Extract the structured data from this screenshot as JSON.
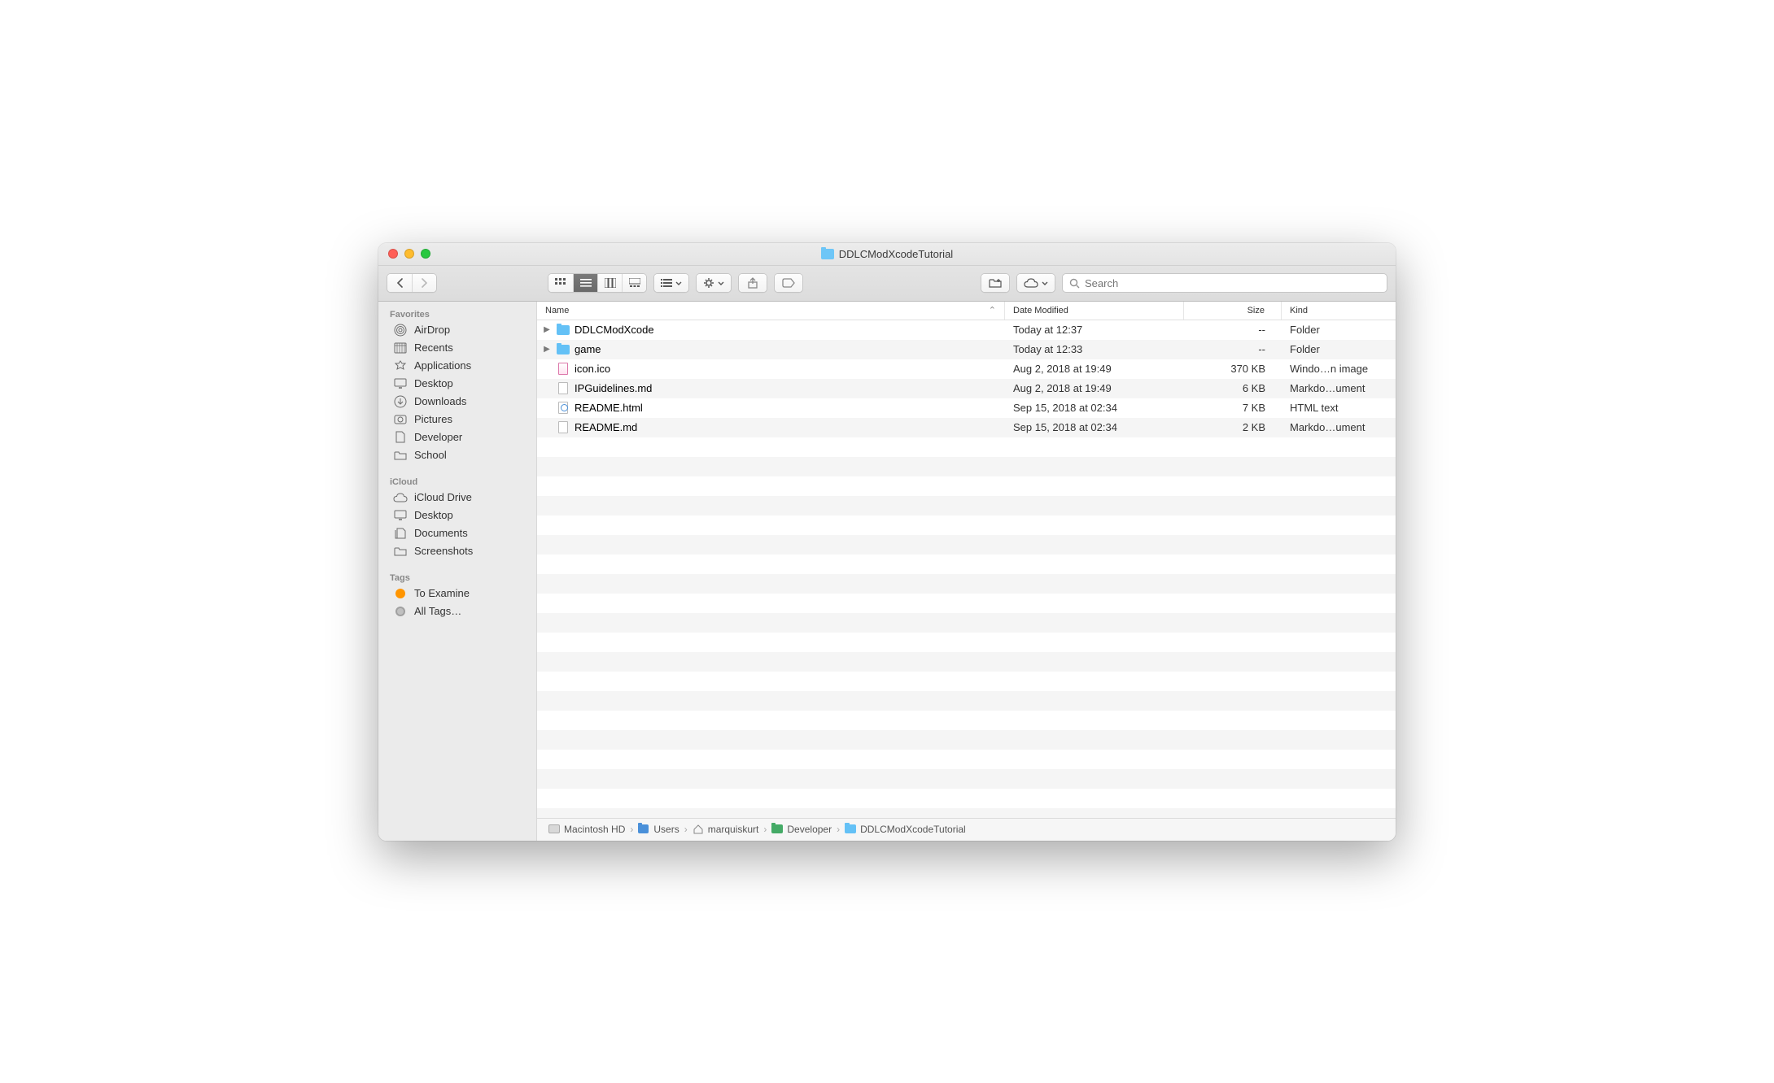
{
  "window": {
    "title": "DDLCModXcodeTutorial"
  },
  "toolbar": {
    "search_placeholder": "Search"
  },
  "sidebar": {
    "sections": [
      {
        "header": "Favorites",
        "items": [
          {
            "label": "AirDrop",
            "icon": "airdrop"
          },
          {
            "label": "Recents",
            "icon": "recents"
          },
          {
            "label": "Applications",
            "icon": "apps"
          },
          {
            "label": "Desktop",
            "icon": "desktop"
          },
          {
            "label": "Downloads",
            "icon": "downloads"
          },
          {
            "label": "Pictures",
            "icon": "pictures"
          },
          {
            "label": "Developer",
            "icon": "doc"
          },
          {
            "label": "School",
            "icon": "folder"
          }
        ]
      },
      {
        "header": "iCloud",
        "items": [
          {
            "label": "iCloud Drive",
            "icon": "cloud"
          },
          {
            "label": "Desktop",
            "icon": "desktop"
          },
          {
            "label": "Documents",
            "icon": "documents"
          },
          {
            "label": "Screenshots",
            "icon": "folder"
          }
        ]
      },
      {
        "header": "Tags",
        "items": [
          {
            "label": "To Examine",
            "icon": "tag-orange"
          },
          {
            "label": "All Tags…",
            "icon": "tag-gray"
          }
        ]
      }
    ]
  },
  "columns": {
    "name": "Name",
    "date": "Date Modified",
    "size": "Size",
    "kind": "Kind"
  },
  "files": [
    {
      "expandable": true,
      "icon": "folder",
      "name": "DDLCModXcode",
      "date": "Today at 12:37",
      "size": "--",
      "kind": "Folder"
    },
    {
      "expandable": true,
      "icon": "folder",
      "name": "game",
      "date": "Today at 12:33",
      "size": "--",
      "kind": "Folder"
    },
    {
      "expandable": false,
      "icon": "ico",
      "name": "icon.ico",
      "date": "Aug 2, 2018 at 19:49",
      "size": "370 KB",
      "kind": "Windo…n image"
    },
    {
      "expandable": false,
      "icon": "md",
      "name": "IPGuidelines.md",
      "date": "Aug 2, 2018 at 19:49",
      "size": "6 KB",
      "kind": "Markdo…ument"
    },
    {
      "expandable": false,
      "icon": "html",
      "name": "README.html",
      "date": "Sep 15, 2018 at 02:34",
      "size": "7 KB",
      "kind": "HTML text"
    },
    {
      "expandable": false,
      "icon": "md",
      "name": "README.md",
      "date": "Sep 15, 2018 at 02:34",
      "size": "2 KB",
      "kind": "Markdo…ument"
    }
  ],
  "pathbar": [
    {
      "label": "Macintosh HD",
      "icon": "hdd"
    },
    {
      "label": "Users",
      "icon": "users"
    },
    {
      "label": "marquiskurt",
      "icon": "home"
    },
    {
      "label": "Developer",
      "icon": "dev"
    },
    {
      "label": "DDLCModXcodeTutorial",
      "icon": "folder"
    }
  ]
}
